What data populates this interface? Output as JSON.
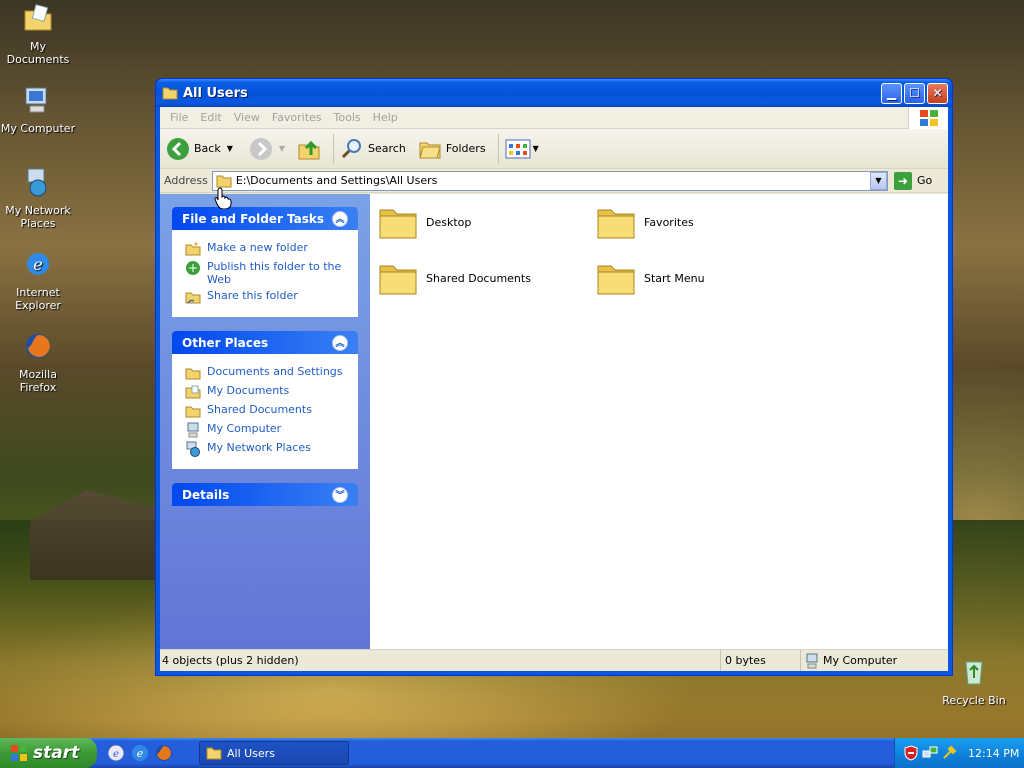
{
  "desktop": {
    "icons": [
      {
        "label": "My Documents"
      },
      {
        "label": "My Computer"
      },
      {
        "label": "My Network Places"
      },
      {
        "label": "Internet Explorer"
      },
      {
        "label": "Mozilla Firefox"
      },
      {
        "label": "Recycle Bin"
      }
    ]
  },
  "window": {
    "title": "All Users",
    "menu": [
      "File",
      "Edit",
      "View",
      "Favorites",
      "Tools",
      "Help"
    ],
    "toolbar": {
      "back": "Back",
      "search": "Search",
      "folders": "Folders"
    },
    "address": {
      "label": "Address",
      "value": "E:\\Documents and Settings\\All Users",
      "go": "Go"
    },
    "taskpane": {
      "file_tasks": {
        "title": "File and Folder Tasks",
        "items": [
          "Make a new folder",
          "Publish this folder to the Web",
          "Share this folder"
        ]
      },
      "other_places": {
        "title": "Other Places",
        "items": [
          "Documents and Settings",
          "My Documents",
          "Shared Documents",
          "My Computer",
          "My Network Places"
        ]
      },
      "details": {
        "title": "Details"
      }
    },
    "folders": [
      "Desktop",
      "Favorites",
      "Shared Documents",
      "Start Menu"
    ],
    "status": {
      "objects": "4 objects (plus 2 hidden)",
      "size": "0 bytes",
      "zone": "My Computer"
    }
  },
  "taskbar": {
    "start": "start",
    "task": "All Users",
    "clock": "12:14 PM"
  },
  "colors": {
    "accent": "#0a58e0",
    "link": "#215dc6",
    "start_green": "#3c9a34"
  }
}
